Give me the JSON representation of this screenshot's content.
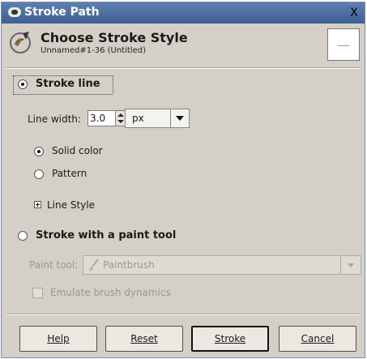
{
  "window": {
    "title": "Stroke Path",
    "close_label": "X"
  },
  "header": {
    "title": "Choose Stroke Style",
    "subtitle": "Unnamed#1-36 (Untitled)",
    "icon": "stroke-brush-icon"
  },
  "stroke_line": {
    "label": "Stroke line",
    "selected": true,
    "line_width_label": "Line width:",
    "line_width_value": "3.0",
    "unit": "px",
    "fill_options": [
      {
        "label": "Solid color",
        "selected": true
      },
      {
        "label": "Pattern",
        "selected": false
      }
    ],
    "line_style_expander_label": "Line Style"
  },
  "paint_tool": {
    "label": "Stroke with a paint tool",
    "selected": false,
    "tool_label": "Paint tool:",
    "tool_value": "Paintbrush",
    "tool_icon": "paintbrush-icon",
    "emulate_label": "Emulate brush dynamics",
    "emulate_checked": false
  },
  "buttons": {
    "help": "Help",
    "reset": "Reset",
    "stroke": "Stroke",
    "cancel": "Cancel"
  },
  "colors": {
    "dialog_bg": "#d4d0c8",
    "titlebar": "#4d6ea3",
    "disabled_text": "#9a978f"
  }
}
